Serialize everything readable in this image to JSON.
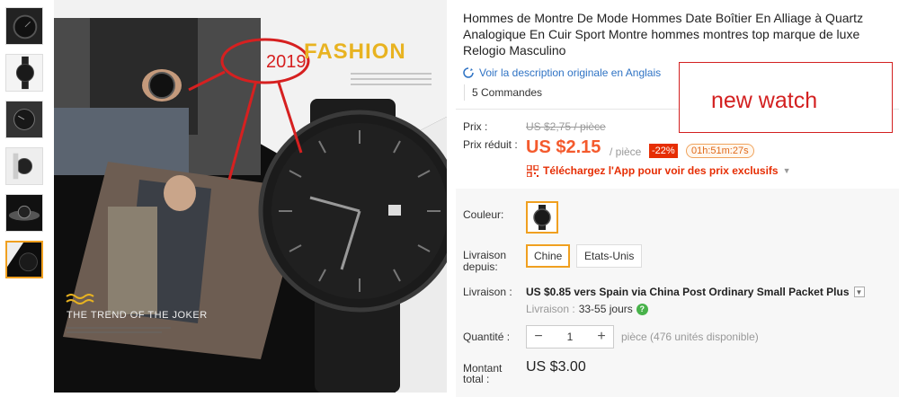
{
  "product": {
    "title": "Hommes de Montre De Mode Hommes Date Boîtier En Alliage à Quartz Analogique En Cuir Sport Montre hommes montres top marque de luxe Relogio Masculino",
    "original_link": "Voir la description originale en Anglais",
    "orders": "5 Commandes"
  },
  "image": {
    "fashion": "FASHION",
    "year": "2019",
    "tagline": "THE TREND OF THE JOKER"
  },
  "annotation": {
    "text": "new watch"
  },
  "price": {
    "label": "Prix :",
    "old": "US $2,75 / pièce",
    "reduced_label": "Prix réduit :",
    "current": "US $2.15",
    "unit": "/ pièce",
    "discount": "-22%",
    "countdown": "01h:51m:27s",
    "app_promo": "Téléchargez l'App pour voir des prix exclusifs"
  },
  "options": {
    "color_label": "Couleur:",
    "ship_from_label_1": "Livraison",
    "ship_from_label_2": "depuis:",
    "ship_from": [
      "Chine",
      "Etats-Unis"
    ]
  },
  "shipping": {
    "label": "Livraison :",
    "main": "US $0.85 vers Spain via China Post Ordinary Small Packet Plus",
    "time_label": "Livraison :",
    "time_value": "33-55 jours"
  },
  "quantity": {
    "label": "Quantité :",
    "value": "1",
    "available": "pièce (476 unités disponible)"
  },
  "total": {
    "label_1": "Montant",
    "label_2": "total :",
    "value": "US $3.00"
  },
  "colors": {
    "accent": "#f45a2d",
    "discount": "#e62e04",
    "selected_border": "#f0a020",
    "link": "#2f73c4"
  }
}
